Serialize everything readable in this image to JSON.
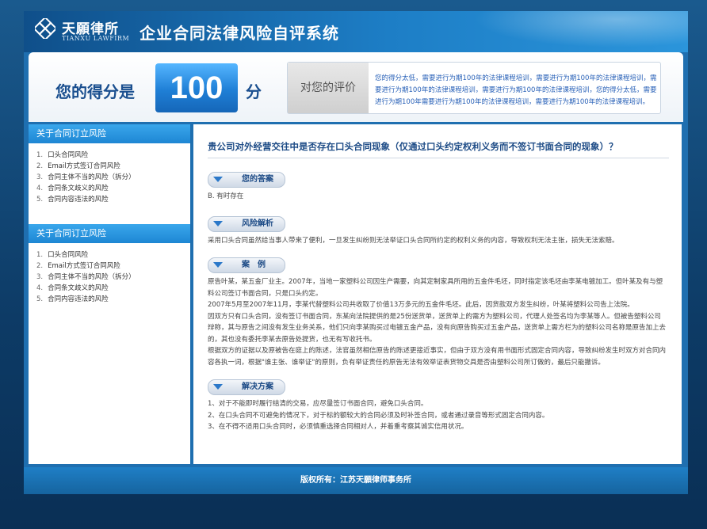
{
  "header": {
    "logo_cn": "天願律所",
    "logo_en": "TIANXU LAWFIRM",
    "system_title": "企业合同法律风险自评系统"
  },
  "score": {
    "label": "您的得分是",
    "value": "100",
    "unit": "分",
    "eval_label": "对您的评价",
    "eval_text": "您的得分太低，需要进行为期100年的法律课程培训，需要进行为期100年的法律课程培训，需要进行为期100年的法律课程培训，需要进行为期100年的法律课程培训，您的得分太低，需要进行为期100年需要进行为期100年的法律课程培训，需要进行为期100年的法律课程培训。"
  },
  "sidebar": {
    "sections": [
      {
        "title": "关于合同订立风险",
        "items": [
          {
            "num": "1.",
            "label": "口头合同风险"
          },
          {
            "num": "2.",
            "label": "Email方式签订合同风险"
          },
          {
            "num": "3.",
            "label": "合同主体不当的风险（拆分）"
          },
          {
            "num": "4.",
            "label": "合同条文歧义的风险"
          },
          {
            "num": "5.",
            "label": "合同内容违法的风险"
          }
        ]
      },
      {
        "title": "关于合同订立风险",
        "items": [
          {
            "num": "1.",
            "label": "口头合同风险"
          },
          {
            "num": "2.",
            "label": "Email方式签订合同风险"
          },
          {
            "num": "3.",
            "label": "合同主体不当的风险（拆分）"
          },
          {
            "num": "4.",
            "label": "合同条文歧义的风险"
          },
          {
            "num": "5.",
            "label": "合同内容违法的风险"
          }
        ]
      }
    ]
  },
  "main": {
    "question": "贵公司对外经营交往中是否存在口头合同现象（仅通过口头约定权利义务而不签订书面合同的现象）？",
    "answer_title": "您的答案",
    "answer_text": "B. 有时存在",
    "risk_title": "风险解析",
    "risk_text": "采用口头合同虽然给当事人带来了便利，一旦发生纠纷则无法举证口头合同所约定的权利义务的内容，导致权利无法主张，损失无法索赔。",
    "case_title": "案　例",
    "case_text": [
      "原告叶某，某五金厂业主。2007年，当地一家塑料公司因生产需要，向其定制家具所用的五金件毛坯，同时指定该毛坯由李某电镀加工。但叶某及有与塑料公司签订书面合同，只是口头约定。",
      "2007年5月至2007年11月，李某代替塑料公司共收取了价值13万多元的五金件毛坯。此后，因货款双方发生纠纷，叶某将塑料公司告上法院。",
      "因双方只有口头合同，没有签订书面合同，东某向法院提供的是25份送货单，送货单上的需方为塑料公司，代理人处签名均为李某等人。但被告塑料公司辩称，其与原告之间没有发生业务关系，他们只向李某购买过电镀五金产品，没有向原告购买过五金产品，送货单上需方栏为的塑料公司名称是原告加上去的，其也没有委托李某去原告处提货，也无有写收托书。",
      "根据双方的证据以及原被告在庭上的陈述，法官虽然相信原告的陈述更接近事实，但由于双方没有用书面形式固定合同内容，导致纠纷发生时双方对合同内容各执一词，根据\"谁主张、谁举证\"的原则，负有举证责任的原告无法有效举证表货物交具是否由塑料公司所订做的，最后只能撤诉。"
    ],
    "solution_title": "解决方案",
    "solution_text": [
      "1、对于不能即时履行结清的交易，应尽量签订书面合同，避免口头合同。",
      "2、在口头合同不可避免的情况下，对于标的额较大的合同必须及时补签合同，或者通过录音等形式固定合同内容。",
      "3、在不得不适用口头合同时，必须慎重选择合同相对人，并着重考察其诚实信用状况。"
    ]
  },
  "footer": {
    "text": "版权所有：江苏天願律师事务所"
  }
}
